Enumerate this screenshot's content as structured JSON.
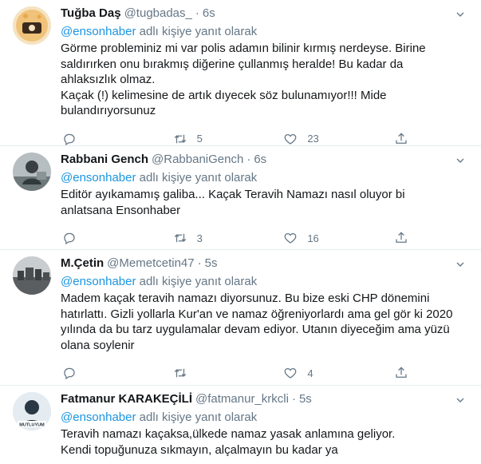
{
  "tweets": [
    {
      "display_name": "Tuğba Daş",
      "handle": "@tugbadas_",
      "dot": "·",
      "time": "6s",
      "reply_mention": "@ensonhaber",
      "reply_suffix": " adlı kişiye yanıt olarak",
      "body": [
        "Görme probleminiz mi var polis adamın bilinir kırmış nerdeyse. Birine saldırırken onu bırakmış diğerine çullanmış heralde! Bu kadar da ahlaksızlık olmaz.",
        "Kaçak (!) kelimesine de artık dıyecek söz bulunamıyor!!! Mide bulandırıyorsunuz"
      ],
      "replies": "",
      "retweets": "5",
      "likes": "23",
      "avatar_colors": [
        "#f3c98f",
        "#3b2a1c"
      ]
    },
    {
      "display_name": "Rabbani Gench",
      "handle": "@RabbaniGench",
      "dot": "·",
      "time": "6s",
      "reply_mention": "@ensonhaber",
      "reply_suffix": " adlı kişiye yanıt olarak",
      "body": [
        "Editör ayıkamamış galiba... Kaçak Teravih Namazı nasıl oluyor bi anlatsana Ensonhaber"
      ],
      "replies": "",
      "retweets": "3",
      "likes": "16",
      "avatar_colors": [
        "#9aa3a6",
        "#2f3a3e"
      ]
    },
    {
      "display_name": "M.Çetin",
      "handle": "@Memetcetin47",
      "dot": "·",
      "time": "5s",
      "reply_mention": "@ensonhaber",
      "reply_suffix": " adlı kişiye yanıt olarak",
      "body": [
        "Madem kaçak teravih namazı diyorsunuz. Bu bize eski CHP dönemini hatırlattı. Gizli yollarla Kur'an ve namaz öğreniyorlardı ama gel gör ki 2020 yılında da bu tarz uygulamalar devam ediyor. Utanın diyeceğim ama yüzü olana soylenir"
      ],
      "replies": "",
      "retweets": "",
      "likes": "4",
      "avatar_colors": [
        "#8c8f92",
        "#3d4042"
      ]
    },
    {
      "display_name": "Fatmanur KARAKEÇİLİ",
      "handle": "@fatmanur_krkcli",
      "dot": "·",
      "time": "5s",
      "reply_mention": "@ensonhaber",
      "reply_suffix": " adlı kişiye yanıt olarak",
      "body": [
        "Teravih  namazı kaçaksa,ülkede namaz yasak anlamına geliyor.",
        "Kendi topuğunuza sıkmayın, alçalmayın bu kadar ya"
      ],
      "replies": "",
      "retweets": "",
      "likes": "",
      "avatar_colors": [
        "#d9e3ea",
        "#1f2d3a"
      ],
      "avatar_text": "MUTLUYUM"
    }
  ],
  "colors": {
    "accent": "#1b95e0",
    "secondary_text": "#657786",
    "primary_text": "#14171a",
    "border": "#e6ecf0"
  },
  "icons": {
    "reply": "reply-icon",
    "retweet": "retweet-icon",
    "like": "heart-icon",
    "share": "share-icon",
    "more": "chevron-down-icon"
  }
}
